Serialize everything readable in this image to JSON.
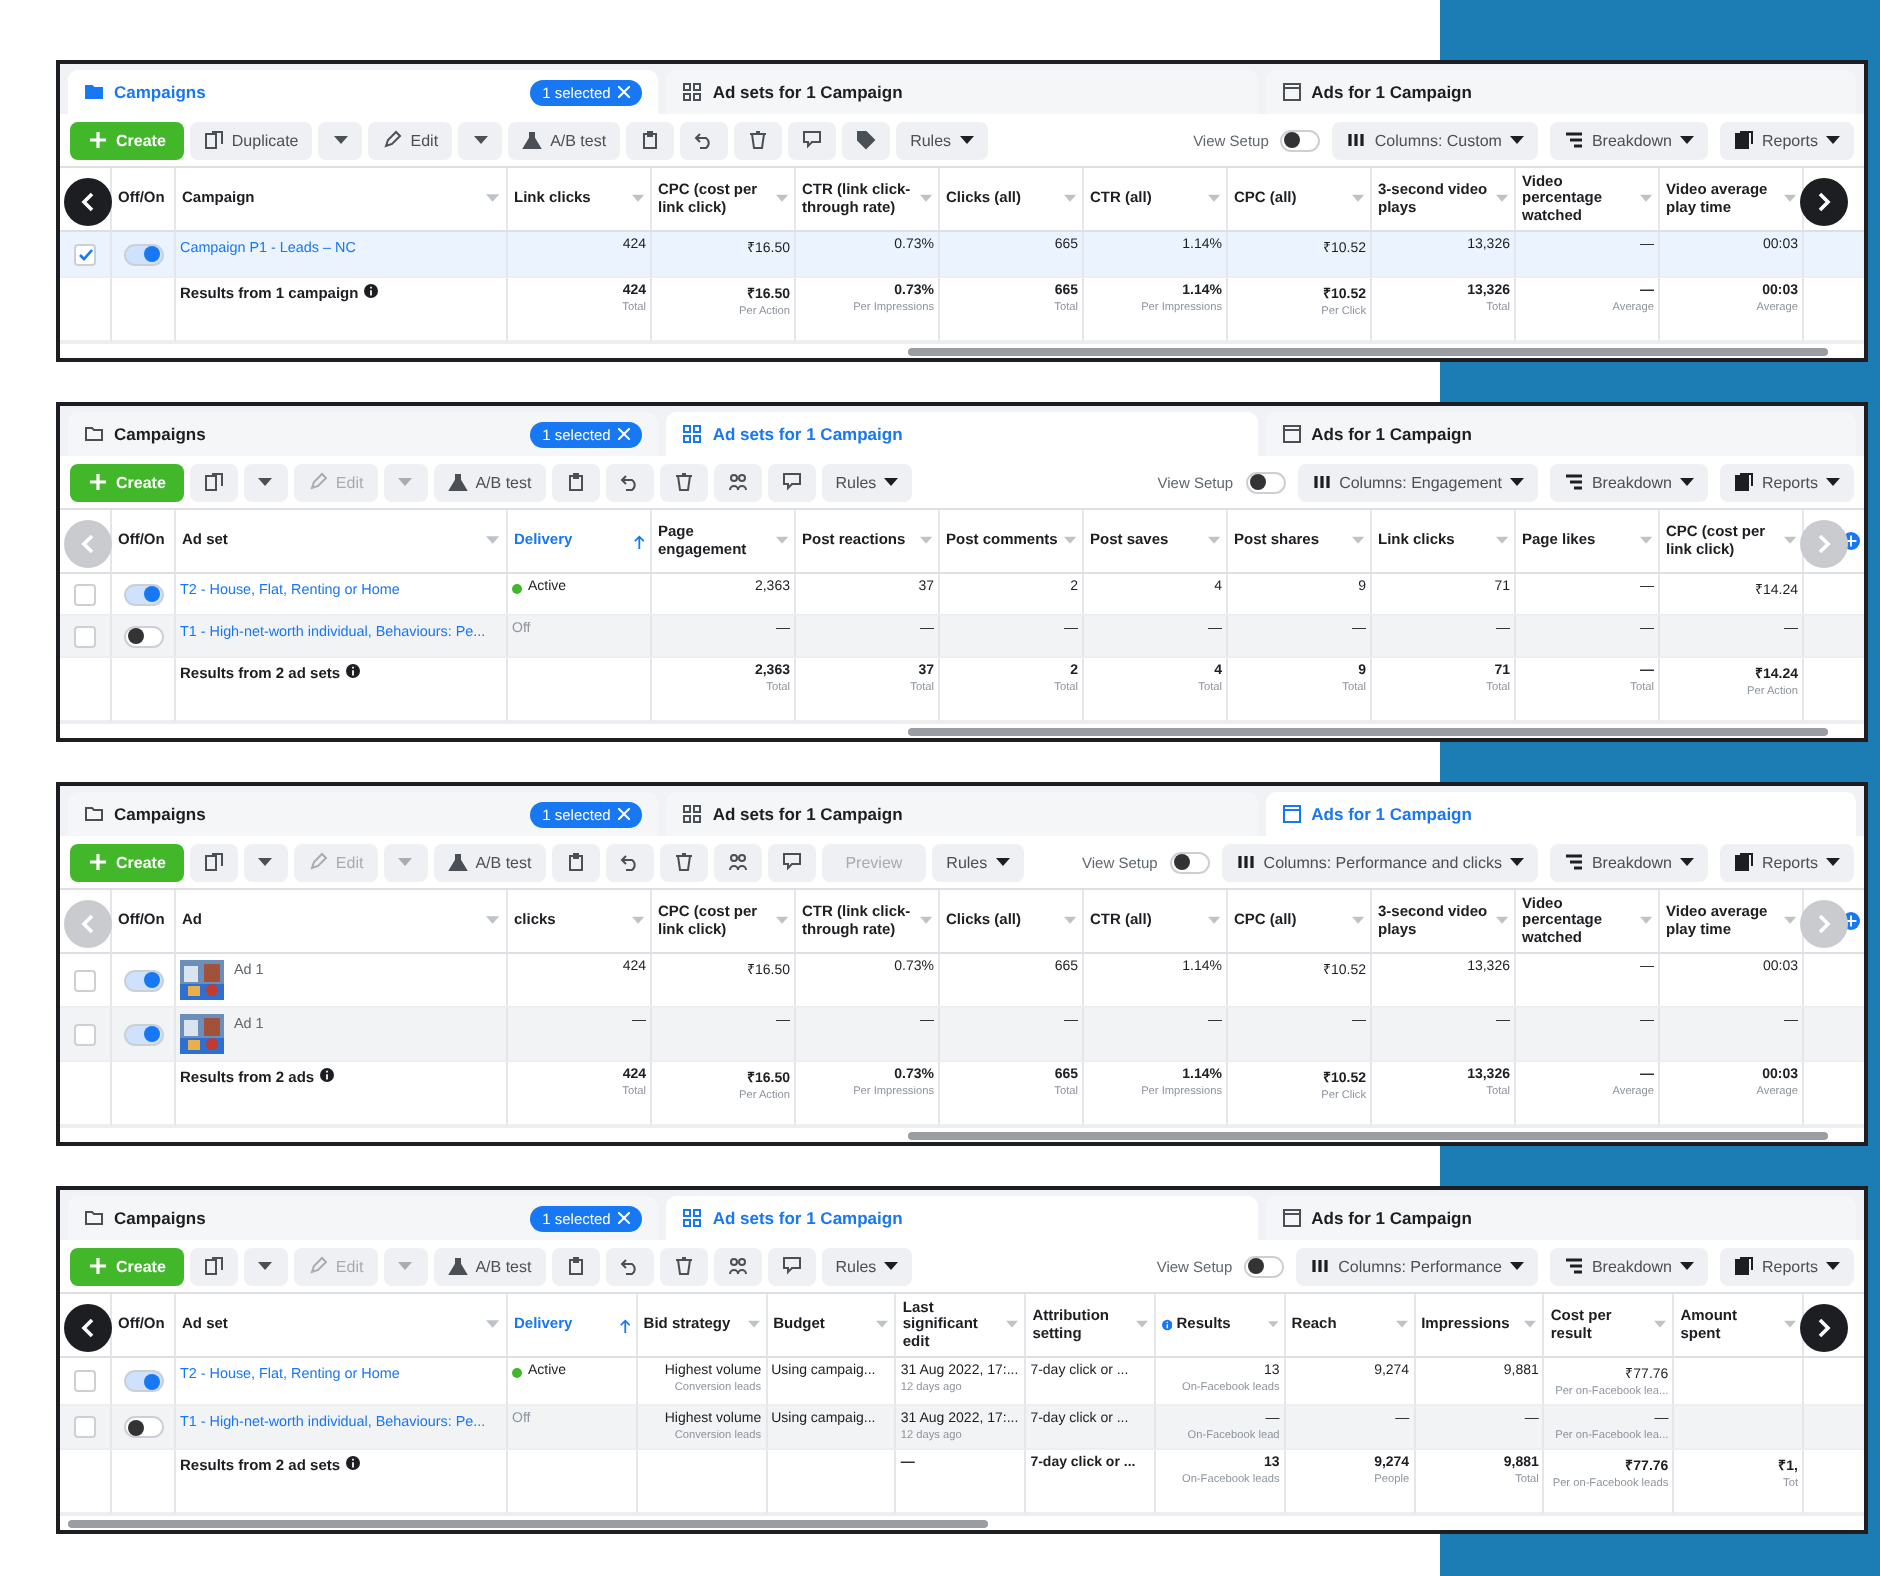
{
  "panels": [
    {
      "tabs": [
        {
          "label": "Campaigns",
          "kind": "folder",
          "selected": true,
          "badge": "1 selected"
        },
        {
          "label": "Ad sets for 1 Campaign",
          "kind": "grid",
          "selected": false
        },
        {
          "label": "Ads for 1 Campaign",
          "kind": "page",
          "selected": false
        }
      ],
      "toolbar": [
        {
          "kind": "create",
          "label": "Create"
        },
        {
          "kind": "copy",
          "label": "Duplicate",
          "split": true,
          "disabled": false
        },
        {
          "kind": "pencil",
          "label": "Edit",
          "split": true,
          "disabled": false
        },
        {
          "kind": "flask",
          "label": "A/B test",
          "disabled": false
        },
        {
          "kind": "clipboard"
        },
        {
          "kind": "undo"
        },
        {
          "kind": "trash"
        },
        {
          "kind": "comment"
        },
        {
          "kind": "tag"
        },
        {
          "kind": "menu",
          "label": "Rules"
        }
      ],
      "view_setup": {
        "label": "View Setup",
        "on": false
      },
      "menus": [
        {
          "kind": "columns",
          "label": "Columns: Custom"
        },
        {
          "kind": "breakdown",
          "label": "Breakdown"
        },
        {
          "kind": "reports",
          "label": "Reports"
        }
      ],
      "toggle_column": "Off/On",
      "name_column": "Campaign",
      "columns": [
        {
          "label": "Link clicks",
          "kind": "right"
        },
        {
          "label": "CPC (cost per link click)",
          "kind": "right"
        },
        {
          "label": "CTR (link click-through rate)",
          "kind": "right"
        },
        {
          "label": "Clicks (all)",
          "kind": "right"
        },
        {
          "label": "CTR (all)",
          "kind": "right"
        },
        {
          "label": "CPC (all)",
          "kind": "right"
        },
        {
          "label": "3-second video plays",
          "kind": "right"
        },
        {
          "label": "Video percentage watched",
          "kind": "right"
        },
        {
          "label": "Video average play time",
          "kind": "right"
        }
      ],
      "rows": [
        {
          "kind": "campaign",
          "checked": true,
          "on": true,
          "name": "Campaign P1 - Leads – NC",
          "cells": [
            "424",
            "₹16.50",
            "0.73%",
            "665",
            "1.14%",
            "₹10.52",
            "13,326",
            "—",
            "00:03"
          ]
        }
      ],
      "totals": {
        "label": "Results from 1 campaign",
        "cells": [
          {
            "value": "424",
            "sub": "Total"
          },
          {
            "value": "₹16.50",
            "sub": "Per Action"
          },
          {
            "value": "0.73%",
            "sub": "Per Impressions"
          },
          {
            "value": "665",
            "sub": "Total"
          },
          {
            "value": "1.14%",
            "sub": "Per Impressions"
          },
          {
            "value": "₹10.52",
            "sub": "Per Click"
          },
          {
            "value": "13,326",
            "sub": "Total"
          },
          {
            "value": "—",
            "sub": "Average"
          },
          {
            "value": "00:03",
            "sub": "Average"
          }
        ]
      },
      "arrows": {
        "dark": true
      }
    },
    {
      "tabs": [
        {
          "label": "Campaigns",
          "kind": "folder",
          "selected": false,
          "badge": "1 selected"
        },
        {
          "label": "Ad sets for 1 Campaign",
          "kind": "grid",
          "selected": true
        },
        {
          "label": "Ads for 1 Campaign",
          "kind": "page",
          "selected": false
        }
      ],
      "toolbar": [
        {
          "kind": "create",
          "label": "Create"
        },
        {
          "kind": "copy",
          "split": true,
          "disabled": false
        },
        {
          "kind": "pencil",
          "label": "Edit",
          "split": true,
          "disabled": true
        },
        {
          "kind": "flask",
          "label": "A/B test",
          "disabled": false
        },
        {
          "kind": "clipboard"
        },
        {
          "kind": "undo"
        },
        {
          "kind": "trash"
        },
        {
          "kind": "people"
        },
        {
          "kind": "comment"
        },
        {
          "kind": "menu",
          "label": "Rules"
        }
      ],
      "view_setup": {
        "label": "View Setup",
        "on": false
      },
      "menus": [
        {
          "kind": "columns",
          "label": "Columns: Engagement"
        },
        {
          "kind": "breakdown",
          "label": "Breakdown"
        },
        {
          "kind": "reports",
          "label": "Reports"
        }
      ],
      "toggle_column": "Off/On",
      "name_column": "Ad set",
      "add_column": true,
      "columns": [
        {
          "label": "Delivery",
          "kind": "sorted"
        },
        {
          "label": "Page engagement",
          "kind": "right"
        },
        {
          "label": "Post reactions",
          "kind": "right"
        },
        {
          "label": "Post comments",
          "kind": "right"
        },
        {
          "label": "Post saves",
          "kind": "right"
        },
        {
          "label": "Post shares",
          "kind": "right"
        },
        {
          "label": "Link clicks",
          "kind": "right"
        },
        {
          "label": "Page likes",
          "kind": "right"
        },
        {
          "label": "CPC (cost per link click)",
          "kind": "right"
        }
      ],
      "rows": [
        {
          "kind": "adset",
          "checked": false,
          "on": true,
          "name": "T2 - House, Flat, Renting or Home",
          "cells": [
            {
              "value": "Active",
              "color": "#42b72a"
            },
            "2,363",
            "37",
            "2",
            "4",
            "9",
            "71",
            "—",
            "₹14.24"
          ]
        },
        {
          "kind": "adset",
          "checked": false,
          "on": false,
          "name": "T1 - High-net-worth individual, Behaviours: Pe...",
          "cells": [
            {
              "value": "Off",
              "dimmed": true
            },
            "—",
            "—",
            "—",
            "—",
            "—",
            "—",
            "—",
            "—"
          ]
        }
      ],
      "totals": {
        "label": "Results from 2 ad sets",
        "cells": [
          null,
          {
            "value": "2,363",
            "sub": "Total"
          },
          {
            "value": "37",
            "sub": "Total"
          },
          {
            "value": "2",
            "sub": "Total"
          },
          {
            "value": "4",
            "sub": "Total"
          },
          {
            "value": "9",
            "sub": "Total"
          },
          {
            "value": "71",
            "sub": "Total"
          },
          {
            "value": "—",
            "sub": "Total"
          },
          {
            "value": "₹14.24",
            "sub": "Per Action"
          }
        ]
      },
      "arrows": {
        "dark": false
      }
    },
    {
      "tabs": [
        {
          "label": "Campaigns",
          "kind": "folder",
          "selected": false,
          "badge": "1 selected"
        },
        {
          "label": "Ad sets for 1 Campaign",
          "kind": "grid",
          "selected": false
        },
        {
          "label": "Ads for 1 Campaign",
          "kind": "page",
          "selected": true
        }
      ],
      "toolbar": [
        {
          "kind": "create",
          "label": "Create"
        },
        {
          "kind": "copy",
          "split": true,
          "disabled": false
        },
        {
          "kind": "pencil",
          "label": "Edit",
          "split": true,
          "disabled": true
        },
        {
          "kind": "flask",
          "label": "A/B test",
          "disabled": false
        },
        {
          "kind": "clipboard"
        },
        {
          "kind": "undo"
        },
        {
          "kind": "trash"
        },
        {
          "kind": "people"
        },
        {
          "kind": "comment"
        },
        {
          "kind": "text",
          "label": "Preview",
          "disabled": true
        },
        {
          "kind": "menu",
          "label": "Rules"
        }
      ],
      "view_setup": {
        "label": "View Setup",
        "on": false
      },
      "menus": [
        {
          "kind": "columns",
          "label": "Columns: Performance and clicks"
        },
        {
          "kind": "breakdown",
          "label": "Breakdown"
        },
        {
          "kind": "reports",
          "label": "Reports"
        }
      ],
      "toggle_column": "Off/On",
      "name_column": "Ad",
      "add_column": true,
      "columns": [
        {
          "label": "clicks",
          "kind": "right"
        },
        {
          "label": "CPC (cost per link click)",
          "kind": "right"
        },
        {
          "label": "CTR (link click-through rate)",
          "kind": "right"
        },
        {
          "label": "Clicks (all)",
          "kind": "right"
        },
        {
          "label": "CTR (all)",
          "kind": "right"
        },
        {
          "label": "CPC (all)",
          "kind": "right"
        },
        {
          "label": "3-second video plays",
          "kind": "right"
        },
        {
          "label": "Video percentage watched",
          "kind": "right"
        },
        {
          "label": "Video average play time",
          "kind": "right"
        }
      ],
      "rows": [
        {
          "kind": "ad",
          "checked": false,
          "on": true,
          "name": "Ad 1",
          "cells": [
            "424",
            "₹16.50",
            "0.73%",
            "665",
            "1.14%",
            "₹10.52",
            "13,326",
            "—",
            "00:03"
          ]
        },
        {
          "kind": "ad",
          "checked": false,
          "on": true,
          "name": "Ad 1",
          "cells": [
            "—",
            "—",
            "—",
            "—",
            "—",
            "—",
            "—",
            "—",
            "—"
          ]
        }
      ],
      "totals": {
        "label": "Results from 2 ads",
        "cells": [
          {
            "value": "424",
            "sub": "Total"
          },
          {
            "value": "₹16.50",
            "sub": "Per Action"
          },
          {
            "value": "0.73%",
            "sub": "Per Impressions"
          },
          {
            "value": "665",
            "sub": "Total"
          },
          {
            "value": "1.14%",
            "sub": "Per Impressions"
          },
          {
            "value": "₹10.52",
            "sub": "Per Click"
          },
          {
            "value": "13,326",
            "sub": "Total"
          },
          {
            "value": "—",
            "sub": "Average"
          },
          {
            "value": "00:03",
            "sub": "Average"
          }
        ]
      },
      "arrows": {
        "dark": false
      }
    },
    {
      "tabs": [
        {
          "label": "Campaigns",
          "kind": "folder",
          "selected": false,
          "badge": "1 selected"
        },
        {
          "label": "Ad sets for 1 Campaign",
          "kind": "grid",
          "selected": true
        },
        {
          "label": "Ads for 1 Campaign",
          "kind": "page",
          "selected": false
        }
      ],
      "toolbar": [
        {
          "kind": "create",
          "label": "Create"
        },
        {
          "kind": "copy",
          "split": true,
          "disabled": false
        },
        {
          "kind": "pencil",
          "label": "Edit",
          "split": true,
          "disabled": true
        },
        {
          "kind": "flask",
          "label": "A/B test",
          "disabled": false
        },
        {
          "kind": "clipboard"
        },
        {
          "kind": "undo"
        },
        {
          "kind": "trash"
        },
        {
          "kind": "people"
        },
        {
          "kind": "comment"
        },
        {
          "kind": "menu",
          "label": "Rules"
        }
      ],
      "view_setup": {
        "label": "View Setup",
        "on": false
      },
      "menus": [
        {
          "kind": "columns",
          "label": "Columns: Performance"
        },
        {
          "kind": "breakdown",
          "label": "Breakdown"
        },
        {
          "kind": "reports",
          "label": "Reports"
        }
      ],
      "toggle_column": "Off/On",
      "name_column": "Ad set",
      "columns": [
        {
          "label": "Delivery",
          "kind": "sorted"
        },
        {
          "label": "Bid strategy",
          "kind": "right"
        },
        {
          "label": "Budget",
          "kind": "left"
        },
        {
          "label": "Last significant edit",
          "kind": "left"
        },
        {
          "label": "Attribution setting",
          "kind": "left"
        },
        {
          "label": "Results",
          "kind": "info"
        },
        {
          "label": "Reach",
          "kind": "right"
        },
        {
          "label": "Impressions",
          "kind": "right"
        },
        {
          "label": "Cost per result",
          "kind": "right"
        },
        {
          "label": "Amount spent",
          "kind": "right"
        }
      ],
      "rows": [
        {
          "kind": "adset",
          "checked": false,
          "on": true,
          "name": "T2 - House, Flat, Renting or Home",
          "cells": [
            {
              "value": "Active",
              "color": "#42b72a"
            },
            {
              "value": "Highest volume",
              "sub": "Conversion leads"
            },
            "Using campaig...",
            {
              "value": "31 Aug 2022, 17:...",
              "sub": "12 days ago"
            },
            "7-day click or ...",
            {
              "value": "13",
              "sub": "On-Facebook leads"
            },
            "9,274",
            "9,881",
            {
              "value": "₹77.76",
              "sub": "Per on-Facebook lea..."
            },
            null
          ]
        },
        {
          "kind": "adset",
          "checked": false,
          "on": false,
          "name": "T1 - High-net-worth individual, Behaviours: Pe...",
          "cells": [
            {
              "value": "Off",
              "dimmed": true
            },
            {
              "value": "Highest volume",
              "sub": "Conversion leads"
            },
            "Using campaig...",
            {
              "value": "31 Aug 2022, 17:...",
              "sub": "12 days ago"
            },
            "7-day click or ...",
            {
              "value": "—",
              "sub": "On-Facebook lead"
            },
            "—",
            "—",
            {
              "value": "—",
              "sub": "Per on-Facebook lea..."
            },
            null
          ]
        }
      ],
      "totals": {
        "label": "Results from 2 ad sets",
        "cells": [
          null,
          null,
          null,
          {
            "value": "—"
          },
          {
            "value": "7-day click or ..."
          },
          {
            "value": "13",
            "sub": "On-Facebook leads"
          },
          {
            "value": "9,274",
            "sub": "People"
          },
          {
            "value": "9,881",
            "sub": "Total"
          },
          {
            "value": "₹77.76",
            "sub": "Per on-Facebook leads"
          },
          {
            "value": "₹1,",
            "sub": "Tot"
          }
        ]
      },
      "arrows": {
        "dark": true
      }
    }
  ]
}
